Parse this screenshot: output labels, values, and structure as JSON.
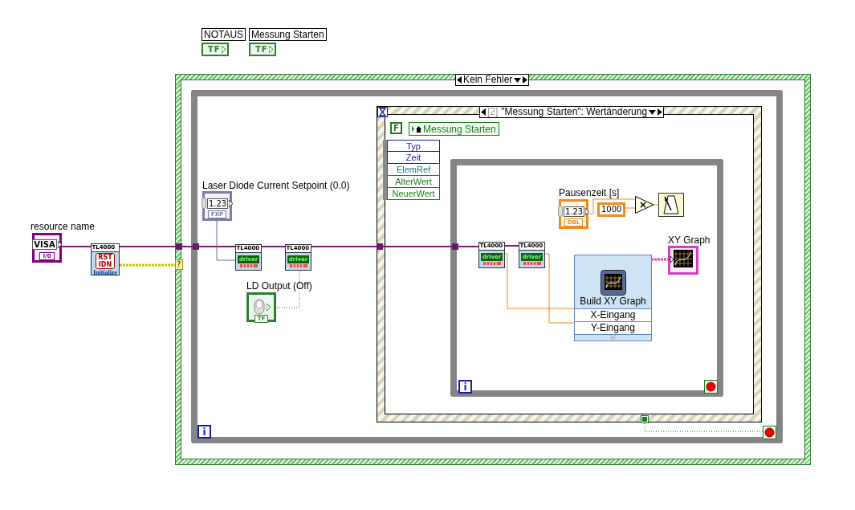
{
  "front_terminals": [
    {
      "label": "NOTAUS",
      "type": "TF"
    },
    {
      "label": "Messung Starten",
      "type": "TF"
    }
  ],
  "case_structure": {
    "selector": "Kein Fehler",
    "error_tunnel": "?"
  },
  "while_loop": {
    "iteration": "i"
  },
  "resource_control": {
    "label": "resource name",
    "value": "VISA",
    "type": "I/0"
  },
  "init_vi": {
    "title": "TL4000",
    "icon_text": [
      "RST",
      "IDN"
    ],
    "caption": "Initialize"
  },
  "outer_nodes": [
    {
      "title": "TL4000",
      "caption": "driver"
    },
    {
      "title": "TL4000",
      "caption": "driver"
    }
  ],
  "setpoint_control": {
    "label": "Laser Diode Current Setpoint (0.0)",
    "value": "1.23",
    "type": "FXP"
  },
  "output_control": {
    "label": "LD Output (Off)",
    "type": "TF"
  },
  "event_structure": {
    "case_index": "[2]",
    "case_label": "\"Messung Starten\": Wertänderung",
    "timeout_constant": "F",
    "event_source": "Messung Starten",
    "event_data": [
      {
        "label": "Typ",
        "color": "#1a1aa8"
      },
      {
        "label": "Zeit",
        "color": "#1a1aa8"
      },
      {
        "label": "ElemRef",
        "color": "#17787a"
      },
      {
        "label": "AlterWert",
        "color": "#1a7a1a"
      },
      {
        "label": "NeuerWert",
        "color": "#1a7a1a"
      }
    ]
  },
  "inner_loop": {
    "iteration": "i",
    "nodes": [
      {
        "title": "TL4000",
        "caption": "driver"
      },
      {
        "title": "TL4000",
        "caption": "driver"
      }
    ],
    "pause_control": {
      "label": "Pausenzeit [s]",
      "value": "1.23",
      "type": "DBL"
    },
    "constant": "1000",
    "multiply": "×",
    "express_vi": {
      "title": "Build XY Graph",
      "inputs": [
        "X-Eingang",
        "Y-Eingang"
      ]
    },
    "graph_terminal": {
      "label": "XY Graph"
    }
  }
}
